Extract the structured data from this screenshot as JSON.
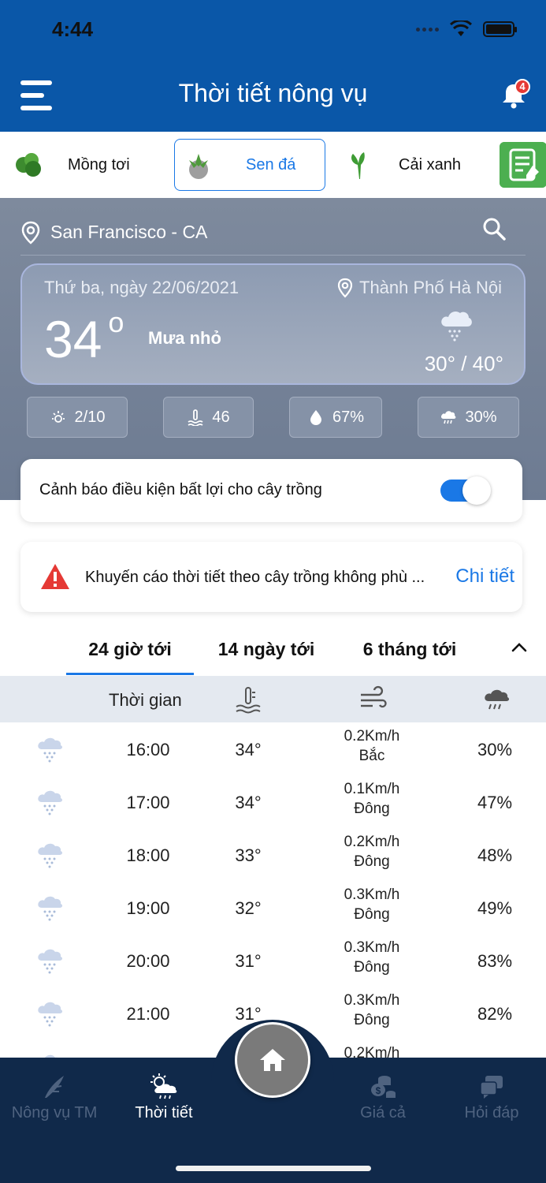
{
  "status_bar": {
    "time": "4:44"
  },
  "header": {
    "title": "Thời tiết nông vụ",
    "notification_count": "4"
  },
  "crops": [
    {
      "label": "Mồng tơi",
      "selected": false
    },
    {
      "label": "Sen đá",
      "selected": true
    },
    {
      "label": "Cải xanh",
      "selected": false
    }
  ],
  "location": {
    "text": "San Francisco - CA"
  },
  "today": {
    "date": "Thứ ba, ngày 22/06/2021",
    "city": "Thành Phố Hà Nội",
    "temperature": "34",
    "degree_symbol": "o",
    "condition": "Mưa nhỏ",
    "range": "30° / 40°"
  },
  "stats": {
    "uv": "2/10",
    "temp_index": "46",
    "humidity": "67%",
    "rain": "30%"
  },
  "alert": {
    "text": "Cảnh báo điều kiện bất lợi cho cây trồng",
    "enabled": true
  },
  "advice": {
    "text": "Khuyến cáo thời tiết theo cây trồng không phù ...",
    "link": "Chi tiết"
  },
  "forecast_tabs": [
    "24 giờ tới",
    "14 ngày tới",
    "6 tháng tới"
  ],
  "table": {
    "time_header": "Thời gian",
    "rows": [
      {
        "time": "16:00",
        "temp": "34°",
        "wind_speed": "0.2Km/h",
        "wind_dir": "Bắc",
        "rain": "30%"
      },
      {
        "time": "17:00",
        "temp": "34°",
        "wind_speed": "0.1Km/h",
        "wind_dir": "Đông",
        "rain": "47%"
      },
      {
        "time": "18:00",
        "temp": "33°",
        "wind_speed": "0.2Km/h",
        "wind_dir": "Đông",
        "rain": "48%"
      },
      {
        "time": "19:00",
        "temp": "32°",
        "wind_speed": "0.3Km/h",
        "wind_dir": "Đông",
        "rain": "49%"
      },
      {
        "time": "20:00",
        "temp": "31°",
        "wind_speed": "0.3Km/h",
        "wind_dir": "Đông",
        "rain": "83%"
      },
      {
        "time": "21:00",
        "temp": "31°",
        "wind_speed": "0.3Km/h",
        "wind_dir": "Đông",
        "rain": "82%"
      },
      {
        "time": "",
        "temp": "",
        "wind_speed": "0.2Km/h",
        "wind_dir": "",
        "rain": ""
      }
    ]
  },
  "bottom_nav": [
    {
      "label": "Nông vụ TM",
      "icon": "farm-icon"
    },
    {
      "label": "Thời tiết",
      "icon": "weather-icon",
      "active": true
    },
    {
      "label": "Giá cả",
      "icon": "coins-icon"
    },
    {
      "label": "Hỏi đáp",
      "icon": "chat-icon"
    }
  ],
  "colors": {
    "primary": "#0a57a8",
    "accent": "#1a78e6",
    "nav_bg": "#10294a",
    "alert_red": "#e53935"
  }
}
